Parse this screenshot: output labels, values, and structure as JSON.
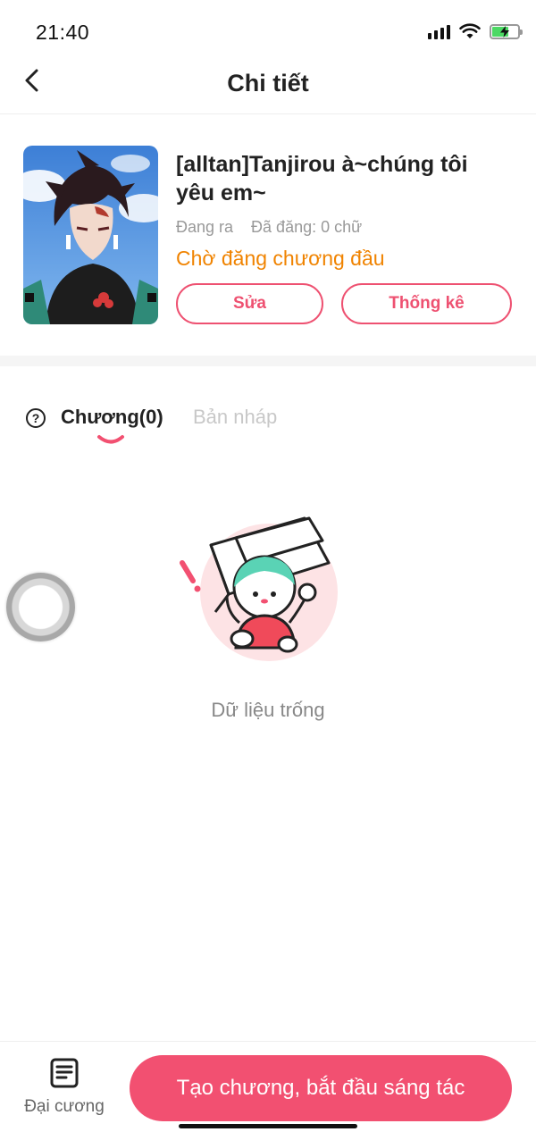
{
  "status_bar": {
    "time": "21:40",
    "icons": [
      "signal-icon",
      "wifi-icon",
      "battery-charging-icon"
    ]
  },
  "header": {
    "back_icon": "chevron-left-icon",
    "title": "Chi tiết"
  },
  "book": {
    "cover_alt": "cover-image",
    "title": "[alltan]Tanjirou à~chúng tôi yêu em~",
    "state": "Đang ra",
    "word_count": "Đã đăng: 0 chữ",
    "status": "Chờ đăng chương đầu",
    "edit_label": "Sửa",
    "stats_label": "Thống kê"
  },
  "tabs": {
    "help_icon": "question-circle-icon",
    "items": [
      {
        "label": "Chương(0)",
        "active": true
      },
      {
        "label": "Bản nháp",
        "active": false
      }
    ]
  },
  "empty_state": {
    "text": "Dữ liệu trống"
  },
  "bottom_bar": {
    "outline_icon": "document-list-icon",
    "outline_label": "Đại cương",
    "primary_label": "Tạo chương, bắt đầu sáng tác"
  },
  "colors": {
    "accent": "#f25071",
    "status_orange": "#f08300",
    "muted_text": "#999999"
  }
}
